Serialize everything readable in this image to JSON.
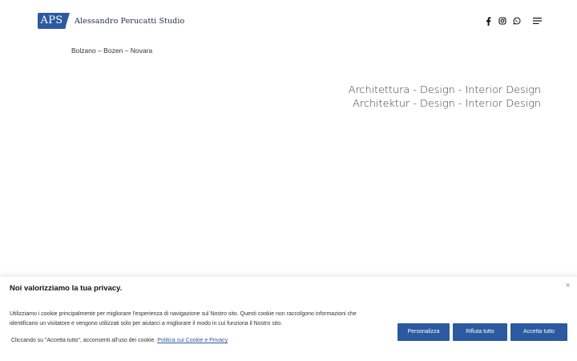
{
  "header": {
    "logo_mark": "APS",
    "studio_name": "Alessandro Perucatti Studio",
    "icons": [
      "facebook-icon",
      "instagram-icon",
      "whatsapp-icon",
      "menu-icon"
    ]
  },
  "locations": "Bolzano – Bozen – Novara",
  "tagline": {
    "line1": "Architettura - Design - Interior Design",
    "line2": "Architektur - Design - Interior Design"
  },
  "cookie": {
    "title": "Noi valorizziamo la tua privacy.",
    "close": "×",
    "description": "Utilizziamo i cookie principalmente per migliorare l'esperienza di navigazione sul Nostro sito. Questi cookie non raccolgono informazioni che identificano un visitatore e vengono utilizzati solo per aiutarci a migliorare il modo in cui funziona il Nostro sito.",
    "consent_text": "Cliccando su \"Accetta tutto\", acconsenti all'uso dei cookie.",
    "policy_link": "Politica sui Cookie e Privacy",
    "buttons": {
      "customize": "Personalizza",
      "reject": "Rifiuta tutto",
      "accept": "Accetta tutto"
    },
    "accent_color": "#2b5aa0"
  }
}
